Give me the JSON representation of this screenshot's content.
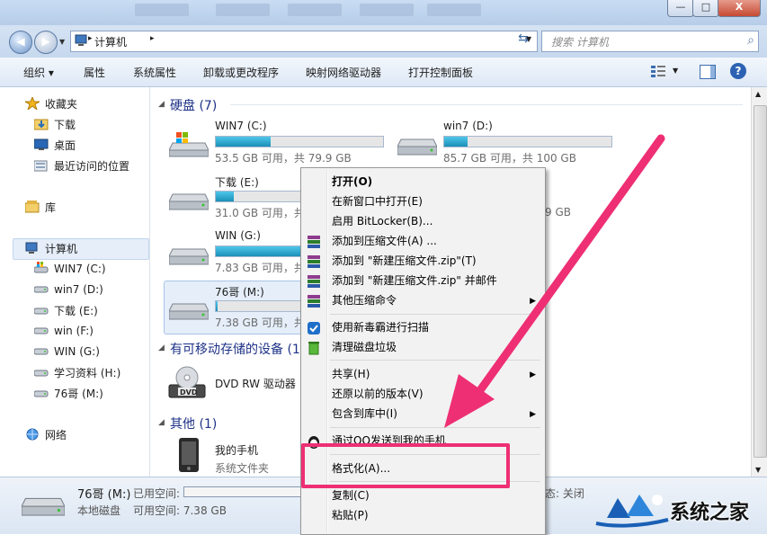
{
  "window": {
    "controls": {
      "minimize": "—",
      "maximize": "□",
      "close": "X"
    }
  },
  "address": {
    "path": "计算机",
    "search_placeholder": "搜索 计算机"
  },
  "toolbar": {
    "organize": "组织 ▾",
    "properties": "属性",
    "system_properties": "系统属性",
    "uninstall": "卸载或更改程序",
    "map_drive": "映射网络驱动器",
    "control_panel": "打开控制面板"
  },
  "sidebar": {
    "favorites": "收藏夹",
    "downloads": "下载",
    "desktop": "桌面",
    "recent": "最近访问的位置",
    "libraries": "库",
    "computer": "计算机",
    "drives": [
      "WIN7 (C:)",
      "win7 (D:)",
      "下载 (E:)",
      "win (F:)",
      "WIN (G:)",
      "学习资料 (H:)",
      "76哥 (M:)"
    ],
    "network": "网络"
  },
  "main": {
    "hdd_group": "硬盘 (7)",
    "removable_group": "有可移动存储的设备 (1)",
    "other_group": "其他 (1)",
    "drives": [
      {
        "name": "WIN7 (C:)",
        "size": "53.5 GB 可用，共 79.9 GB",
        "used": 0.33
      },
      {
        "name": "win7 (D:)",
        "size": "85.7 GB 可用，共 100 GB",
        "used": 0.14
      },
      {
        "name": "下载 (E:)",
        "size": "31.0 GB 可用，共",
        "used": 0.11
      },
      {
        "name": "WIN (G:)",
        "size": "7.83 GB 可用，共",
        "used": 0.9
      },
      {
        "name": "76哥 (M:)",
        "size": "7.38 GB 可用，共",
        "used": 0.01
      }
    ],
    "partial_right_1": "9 GB",
    "dvd": "DVD RW 驱动器",
    "phone_name": "我的手机",
    "phone_type": "系统文件夹"
  },
  "status": {
    "drive_name": "76哥 (M:)",
    "used_label": "已用空间:",
    "type": "本地磁盘",
    "free_label": "可用空间: 7.38 GB",
    "state": "态: 关闭"
  },
  "context_menu": {
    "items": [
      "打开(O)",
      "在新窗口中打开(E)",
      "启用 BitLocker(B)...",
      "添加到压缩文件(A) ...",
      "添加到 \"新建压缩文件.zip\"(T)",
      "添加到 \"新建压缩文件.zip\" 并邮件",
      "其他压缩命令",
      "使用新毒霸进行扫描",
      "清理磁盘垃圾",
      "共享(H)",
      "还原以前的版本(V)",
      "包含到库中(I)",
      "通过QQ发送到我的手机",
      "格式化(A)...",
      "复制(C)",
      "粘贴(P)"
    ]
  },
  "watermark": {
    "text": "系统之家"
  },
  "colors": {
    "annotation": "#ee2f74",
    "drive_fill": "#1b8fb8",
    "group_title": "#1e3287"
  }
}
